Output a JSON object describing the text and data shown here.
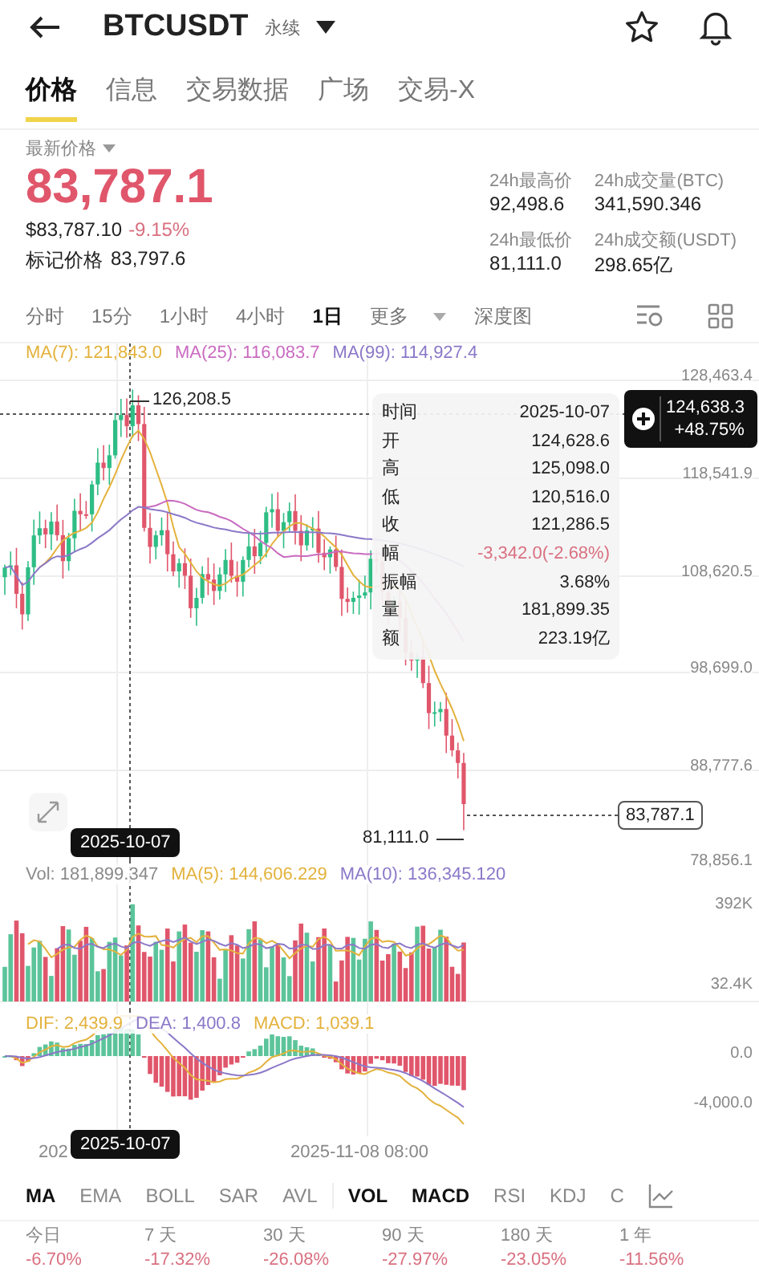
{
  "header": {
    "symbol": "BTCUSDT",
    "contract": "永续"
  },
  "tabs": [
    {
      "label": "价格",
      "selected": true
    },
    {
      "label": "信息",
      "selected": false
    },
    {
      "label": "交易数据",
      "selected": false
    },
    {
      "label": "广场",
      "selected": false
    },
    {
      "label": "交易-X",
      "selected": false
    }
  ],
  "price": {
    "label": "最新价格",
    "last": "83,787.1",
    "usd": "$83,787.10",
    "change": "-9.15%",
    "mark_label": "标记价格",
    "mark": "83,797.6"
  },
  "stats": [
    {
      "label": "24h最高价",
      "value": "92,498.6"
    },
    {
      "label": "24h成交量(BTC)",
      "value": "341,590.346"
    },
    {
      "label": "24h最低价",
      "value": "81,111.0"
    },
    {
      "label": "24h成交额(USDT)",
      "value": "298.65亿"
    }
  ],
  "intervals": [
    {
      "label": "分时",
      "kind": "option",
      "selected": false
    },
    {
      "label": "15分",
      "kind": "option",
      "selected": false
    },
    {
      "label": "1小时",
      "kind": "option",
      "selected": false
    },
    {
      "label": "4小时",
      "kind": "option",
      "selected": false
    },
    {
      "label": "1日",
      "kind": "option",
      "selected": true
    },
    {
      "label": "更多",
      "kind": "dropdown",
      "selected": false
    },
    {
      "label": "深度图",
      "kind": "option",
      "selected": false
    }
  ],
  "chart": {
    "ma_legend": [
      {
        "label": "MA(7): 121,843.0",
        "color": "#e3b23c"
      },
      {
        "label": "MA(25): 116,083.7",
        "color": "#c96bc0"
      },
      {
        "label": "MA(99): 114,927.4",
        "color": "#8b78c8"
      }
    ],
    "y_labels": [
      "128,463.4",
      "118,541.9",
      "108,620.5",
      "98,699.0",
      "88,777.6",
      "78,856.1"
    ],
    "high_label": "126,208.5",
    "low_label": "81,111.0",
    "current_price": "83,787.1",
    "crosshair_price": "124,638.3",
    "crosshair_change": "+48.75%",
    "crosshair_date": "2025-10-07",
    "tooltip": [
      {
        "label": "时间",
        "value": "2025-10-07",
        "color": "#222222"
      },
      {
        "label": "开",
        "value": "124,628.6",
        "color": "#222222"
      },
      {
        "label": "高",
        "value": "125,098.0",
        "color": "#222222"
      },
      {
        "label": "低",
        "value": "120,516.0",
        "color": "#222222"
      },
      {
        "label": "收",
        "value": "121,286.5",
        "color": "#222222"
      },
      {
        "label": "幅",
        "value": "-3,342.0(-2.68%)",
        "color": "#d97080"
      },
      {
        "label": "振幅",
        "value": "3.68%",
        "color": "#222222"
      },
      {
        "label": "量",
        "value": "181,899.35",
        "color": "#222222"
      },
      {
        "label": "额",
        "value": "223.19亿",
        "color": "#222222"
      }
    ]
  },
  "volume": {
    "legend": [
      {
        "label": "Vol: 181,899.347",
        "color": "#8a8a8a"
      },
      {
        "label": "MA(5): 144,606.229",
        "color": "#e3b23c"
      },
      {
        "label": "MA(10): 136,345.120",
        "color": "#8b78c8"
      }
    ],
    "y_labels": [
      "392K",
      "32.4K"
    ]
  },
  "macd": {
    "legend": [
      {
        "label": "DIF: 2,439.9",
        "color": "#e3b23c"
      },
      {
        "label": "DEA: 1,400.8",
        "color": "#8b78c8"
      },
      {
        "label": "MACD: 1,039.1",
        "color": "#e3b23c"
      }
    ],
    "y_labels": [
      "0.0",
      "-4,000.0"
    ]
  },
  "x_axis": {
    "labels": [
      "202",
      "2025-11-08 08:00"
    ],
    "crosshair_date": "2025-10-07"
  },
  "main_indicators": [
    {
      "label": "MA",
      "selected": true
    },
    {
      "label": "EMA",
      "selected": false
    },
    {
      "label": "BOLL",
      "selected": false
    },
    {
      "label": "SAR",
      "selected": false
    },
    {
      "label": "AVL",
      "selected": false
    }
  ],
  "sub_indicators": [
    {
      "label": "VOL",
      "selected": true
    },
    {
      "label": "MACD",
      "selected": true
    },
    {
      "label": "RSI",
      "selected": false
    },
    {
      "label": "KDJ",
      "selected": false
    },
    {
      "label": "C",
      "selected": false
    }
  ],
  "performance": [
    {
      "period": "今日",
      "change": "-6.70%"
    },
    {
      "period": "7 天",
      "change": "-17.32%"
    },
    {
      "period": "30 天",
      "change": "-26.08%"
    },
    {
      "period": "90 天",
      "change": "-27.97%"
    },
    {
      "period": "180 天",
      "change": "-23.05%"
    },
    {
      "period": "1 年",
      "change": "-11.56%"
    }
  ]
}
